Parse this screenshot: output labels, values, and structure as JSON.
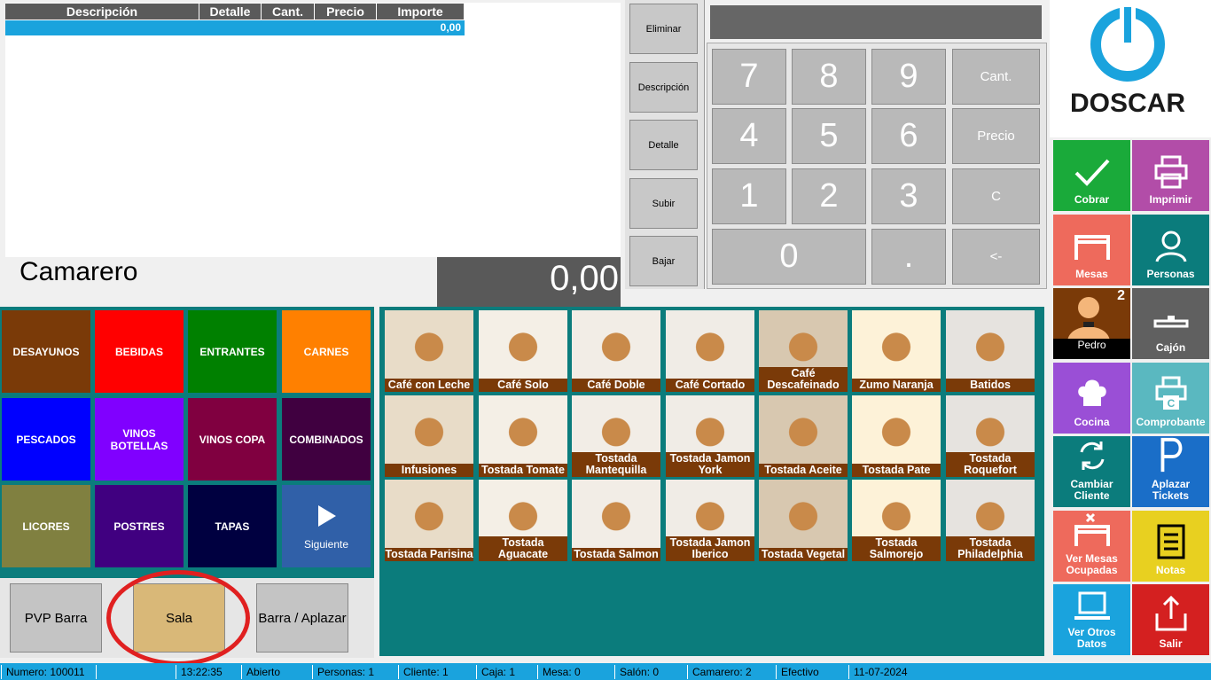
{
  "ticket": {
    "columns": [
      "Descripción",
      "Detalle",
      "Cant.",
      "Precio",
      "Importe"
    ],
    "row_total": "0,00"
  },
  "waiter_label": "Camarero",
  "total": "0,00",
  "edit_buttons": [
    "Eliminar",
    "Descripción",
    "Detalle",
    "Subir",
    "Bajar"
  ],
  "keypad": {
    "digits": [
      "7",
      "8",
      "9",
      "4",
      "5",
      "6",
      "1",
      "2",
      "3",
      "0",
      "."
    ],
    "functions": [
      "Cant.",
      "Precio",
      "C",
      "<-"
    ]
  },
  "logo": {
    "text": "DOSCAR"
  },
  "actions": {
    "cobrar": "Cobrar",
    "imprimir": "Imprimir",
    "mesas": "Mesas",
    "personas": "Personas",
    "waiter_name": "Pedro",
    "waiter_number": "2",
    "cajon": "Cajón",
    "cocina": "Cocina",
    "comprobante": "Comprobante",
    "cambiar_cliente": "Cambiar Cliente",
    "aplazar_tickets": "Aplazar Tickets",
    "ver_mesas": "Ver Mesas Ocupadas",
    "notas": "Notas",
    "ver_otros": "Ver Otros Datos",
    "salir": "Salir"
  },
  "categories": [
    {
      "label": "DESAYUNOS",
      "color": "#7a3a08"
    },
    {
      "label": "BEBIDAS",
      "color": "#ff0000"
    },
    {
      "label": "ENTRANTES",
      "color": "#008000"
    },
    {
      "label": "CARNES",
      "color": "#ff8000"
    },
    {
      "label": "PESCADOS",
      "color": "#0000ff"
    },
    {
      "label": "VINOS BOTELLAS",
      "color": "#8000ff"
    },
    {
      "label": "VINOS COPA",
      "color": "#800040"
    },
    {
      "label": "COMBINADOS",
      "color": "#400040"
    },
    {
      "label": "LICORES",
      "color": "#808040"
    },
    {
      "label": "POSTRES",
      "color": "#400080"
    },
    {
      "label": "TAPAS",
      "color": "#000040"
    },
    {
      "label": "Siguiente",
      "color": "#3060a8"
    }
  ],
  "modes": [
    "PVP Barra",
    "Sala",
    "Barra / Aplazar"
  ],
  "products": [
    [
      "Café con Leche",
      "Café Solo",
      "Café Doble",
      "Café Cortado",
      "Café Descafeinado",
      "Zumo Naranja",
      "Batidos"
    ],
    [
      "Infusiones",
      "Tostada Tomate",
      "Tostada Mantequilla",
      "Tostada Jamon York",
      "Tostada Aceite",
      "Tostada Pate",
      "Tostada Roquefort"
    ],
    [
      "Tostada Parisina",
      "Tostada Aguacate",
      "Tostada Salmon",
      "Tostada Jamon Iberico",
      "Tostada Vegetal",
      "Tostada Salmorejo",
      "Tostada Philadelphia"
    ]
  ],
  "status": [
    "Numero: 100011",
    "",
    "13:22:35",
    "Abierto",
    "Personas: 1",
    "Cliente: 1",
    "Caja: 1",
    "Mesa: 0",
    "Salón: 0",
    "Camarero: 2",
    "Efectivo",
    "11-07-2024"
  ]
}
